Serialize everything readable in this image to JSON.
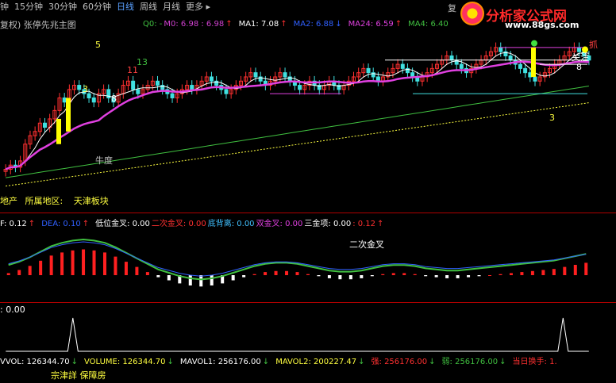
{
  "toolbar": {
    "tabs": [
      {
        "label": "钟",
        "active": false
      },
      {
        "label": "15分钟",
        "active": false
      },
      {
        "label": "30分钟",
        "active": false
      },
      {
        "label": "60分钟",
        "active": false
      },
      {
        "label": "日线",
        "active": true
      },
      {
        "label": "周线",
        "active": false
      },
      {
        "label": "月线",
        "active": false
      },
      {
        "label": "更多 ▸",
        "active": false
      }
    ],
    "right_glyph": "复"
  },
  "logo": {
    "title": "分析家公式网",
    "url": "www.88gs.com"
  },
  "main_panel": {
    "title": "复权) 张停先兆主图",
    "indicators": [
      {
        "text": "Q0: -",
        "color": "#40c040"
      },
      {
        "text": "M0: 6.98 : 6.98",
        "color": "#d040d0"
      },
      {
        "text": "↑",
        "color": "#ff3030"
      },
      {
        "text": "MA1: 7.08",
        "color": "#ffffff"
      },
      {
        "text": "↑",
        "color": "#ff3030"
      },
      {
        "text": "MA2: 6.88",
        "color": "#3060ff"
      },
      {
        "text": "↓",
        "color": "#3060ff"
      },
      {
        "text": "MA24: 6.59",
        "color": "#e040e0"
      },
      {
        "text": "↑",
        "color": "#ff3030"
      },
      {
        "text": "MA4: 6.40",
        "color": "#40c040"
      }
    ],
    "annotations": [
      {
        "text": "5",
        "color": "#ffff40"
      },
      {
        "text": "11",
        "color": "#ff4040"
      },
      {
        "text": "13",
        "color": "#40c040"
      },
      {
        "text": "3",
        "color": "#ffff40"
      },
      {
        "text": "8",
        "color": "#ffffff"
      },
      {
        "text": "牛度",
        "color": "#c0c0c0"
      },
      {
        "text": "3",
        "color": "#ffff40"
      },
      {
        "text": "8",
        "color": "#ffffff"
      },
      {
        "text": "关注",
        "color": "#ffffff"
      },
      {
        "text": "抓",
        "color": "#ff4040"
      }
    ],
    "info_line": {
      "a": "地产",
      "b": "所属地区:",
      "c": "天津板块"
    }
  },
  "macd_panel": {
    "header": [
      {
        "text": "F: 0.12",
        "color": "#ffffff"
      },
      {
        "text": "↑",
        "color": "#ff3030"
      },
      {
        "text": "DEA: 0.10",
        "color": "#3060ff"
      },
      {
        "text": "↑",
        "color": "#ff3030"
      },
      {
        "text": "低位金叉: 0.00",
        "color": "#ffffff"
      },
      {
        "text": "二次金叉: 0.00",
        "color": "#ff3030"
      },
      {
        "text": "底背离: 0.00",
        "color": "#40c0ff"
      },
      {
        "text": "双金叉: 0.00",
        "color": "#e040e0"
      },
      {
        "text": "三金项: 0.00",
        "color": "#ffffff"
      },
      {
        "text": ": 0.12",
        "color": "#ff3030"
      },
      {
        "text": "↑",
        "color": "#ff3030"
      }
    ],
    "label_second_cross": "二次金叉"
  },
  "signal_panel": {
    "header": ": 0.00"
  },
  "volume_panel": {
    "header": [
      {
        "text": "VVOL: 126344.70",
        "color": "#ffffff"
      },
      {
        "text": "↓",
        "color": "#40c040"
      },
      {
        "text": "VOLUME: 126344.70",
        "color": "#ffff40"
      },
      {
        "text": "↓",
        "color": "#40c040"
      },
      {
        "text": "MAVOL1: 256176.00",
        "color": "#ffffff"
      },
      {
        "text": "↓",
        "color": "#40c040"
      },
      {
        "text": "MAVOL2: 200227.47",
        "color": "#ffff40"
      },
      {
        "text": "↓",
        "color": "#40c040"
      },
      {
        "text": "强: 256176.00",
        "color": "#ff3030"
      },
      {
        "text": "↓",
        "color": "#40c040"
      },
      {
        "text": "弱: 256176.00",
        "color": "#40c040"
      },
      {
        "text": "↓",
        "color": "#40c040"
      },
      {
        "text": "当日换手: 1.",
        "color": "#ff3030"
      }
    ],
    "footer": "宗津詳 保障房"
  },
  "chart_data": [
    {
      "type": "candlestick",
      "title": "张停先兆主图",
      "close": [
        4.7,
        4.8,
        4.75,
        4.9,
        5.3,
        5.5,
        5.6,
        5.8,
        5.7,
        5.9,
        6.1,
        6.4,
        6.3,
        6.6,
        6.7,
        6.6,
        6.5,
        6.4,
        6.3,
        6.5,
        6.6,
        6.4,
        6.3,
        6.5,
        6.7,
        6.8,
        6.6,
        6.5,
        6.6,
        6.7,
        6.8,
        6.7,
        6.6,
        6.5,
        6.4,
        6.5,
        6.6,
        6.7,
        6.6,
        6.7,
        6.8,
        6.9,
        6.8,
        6.7,
        6.6,
        6.5,
        6.6,
        6.7,
        6.8,
        6.9,
        7.0,
        6.9,
        6.8,
        6.7,
        6.8,
        6.9,
        7.0,
        6.9,
        6.8,
        6.7,
        6.6,
        6.7,
        6.8,
        6.7,
        6.6,
        6.7,
        6.8,
        6.7,
        6.6,
        6.7,
        6.8,
        6.9,
        7.0,
        7.1,
        7.0,
        6.9,
        6.8,
        6.9,
        7.0,
        7.1,
        7.2,
        7.1,
        7.0,
        6.9,
        6.8,
        6.9,
        7.0,
        7.1,
        7.2,
        7.3,
        7.4,
        7.3,
        7.2,
        7.1,
        7.0,
        7.1,
        7.2,
        7.3,
        7.4,
        7.5,
        7.6,
        7.5,
        7.4,
        7.3,
        7.2,
        7.1,
        7.0,
        6.9,
        6.8,
        6.9,
        7.0,
        7.1,
        7.2,
        7.3,
        7.4,
        7.5,
        7.6,
        7.5,
        7.4,
        7.3
      ],
      "ylim": [
        4.2,
        7.9
      ]
    },
    {
      "type": "bar",
      "title": "MACD",
      "series": [
        {
          "name": "F",
          "values": [
            0.02,
            0.05,
            0.09,
            0.14,
            0.19,
            0.22,
            0.24,
            0.25,
            0.24,
            0.22,
            0.18,
            0.13,
            0.08,
            0.03,
            -0.02,
            -0.05,
            -0.08,
            -0.1,
            -0.11,
            -0.1,
            -0.08,
            -0.05,
            -0.02,
            0.01,
            0.03,
            0.04,
            0.04,
            0.03,
            0.01,
            -0.01,
            -0.03,
            -0.04,
            -0.04,
            -0.03,
            -0.01,
            0.01,
            0.02,
            0.02,
            0.01,
            -0.01,
            -0.02,
            -0.03,
            -0.03,
            -0.02,
            -0.01,
            0.0,
            0.01,
            0.02,
            0.03,
            0.04,
            0.05,
            0.06,
            0.08,
            0.1,
            0.12
          ]
        }
      ]
    },
    {
      "type": "line",
      "title": "signal",
      "values": [
        0,
        0,
        0,
        0,
        0,
        0,
        0,
        0,
        0,
        0,
        0,
        0,
        0,
        1,
        0,
        0,
        0,
        0,
        0,
        0,
        0,
        0,
        0,
        0,
        0,
        0,
        0,
        0,
        0,
        0,
        0,
        0,
        0,
        0,
        0,
        0,
        0,
        0,
        0,
        0,
        0,
        0,
        0,
        0,
        0,
        0,
        0,
        0,
        0,
        0,
        0,
        0,
        0,
        0,
        0,
        0,
        0,
        0,
        0,
        0,
        0,
        0,
        0,
        0,
        0,
        0,
        0,
        0,
        0,
        0,
        0,
        0,
        0,
        0,
        0,
        0,
        0,
        0,
        0,
        0,
        0,
        0,
        0,
        0,
        0,
        0,
        0,
        0,
        0,
        0,
        0,
        0,
        0,
        0,
        0,
        0,
        0,
        0,
        0,
        0,
        0,
        0,
        0,
        0,
        0,
        0,
        0,
        0,
        1,
        0,
        0,
        0,
        0,
        0
      ]
    }
  ]
}
